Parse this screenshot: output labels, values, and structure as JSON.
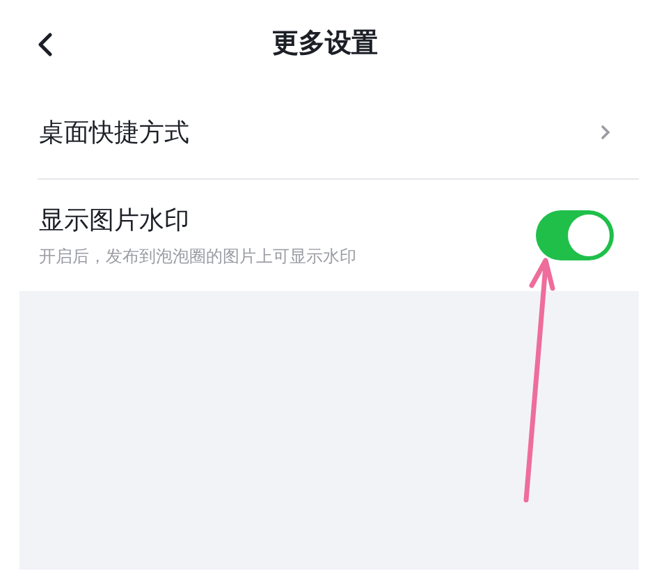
{
  "header": {
    "title": "更多设置"
  },
  "settings": [
    {
      "kind": "link",
      "label": "桌面快捷方式"
    },
    {
      "kind": "switch",
      "label": "显示图片水印",
      "description": "开启后，发布到泡泡圈的图片上可显示水印",
      "on": true
    }
  ],
  "pointer_arrow": true
}
